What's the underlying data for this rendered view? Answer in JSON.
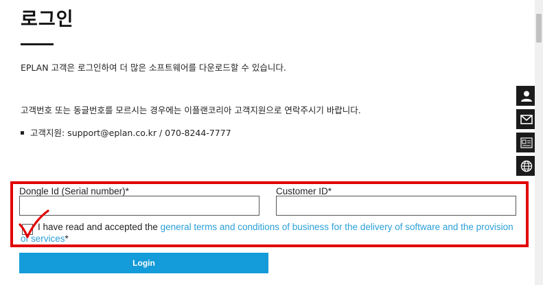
{
  "header": {
    "title": "로그인",
    "intro": "EPLAN 고객은 로그인하여 더 많은 소프트웨어를 다운로드할 수 있습니다."
  },
  "help": {
    "text": "고객번호 또는 동글번호를 모르시는 경우에는 이플랜코리아 고객지원으로 연락주시기 바랍니다.",
    "support": "고객지원: support@eplan.co.kr / 070-8244-7777"
  },
  "form": {
    "dongle_label": "Dongle Id (Serial number)*",
    "dongle_value": "",
    "customer_label": "Customer ID*",
    "customer_value": "",
    "terms_prefix": "I have read and accepted the ",
    "terms_link": "general terms and conditions of business for the delivery of software and the provision of services",
    "terms_suffix": "*",
    "login_label": "Login"
  },
  "side_buttons": [
    {
      "icon": "user-icon"
    },
    {
      "icon": "mail-icon"
    },
    {
      "icon": "id-card-icon"
    },
    {
      "icon": "globe-icon"
    }
  ],
  "colors": {
    "accent": "#149bd9",
    "link": "#2a9fd8",
    "highlight": "#e10000"
  }
}
